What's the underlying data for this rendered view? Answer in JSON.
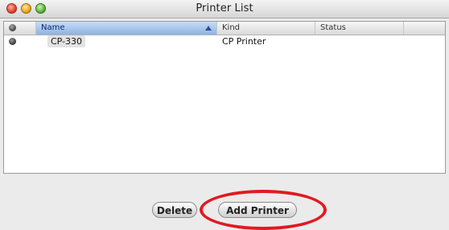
{
  "window": {
    "title": "Printer List"
  },
  "table": {
    "headers": {
      "name": "Name",
      "kind": "Kind",
      "status": "Status"
    },
    "rows": [
      {
        "name": "CP-330",
        "kind": "CP Printer",
        "status": ""
      }
    ]
  },
  "buttons": {
    "delete": "Delete",
    "add_printer": "Add Printer"
  },
  "colors": {
    "highlight": "#e11a22",
    "sort_header": "#8fb2e3"
  }
}
